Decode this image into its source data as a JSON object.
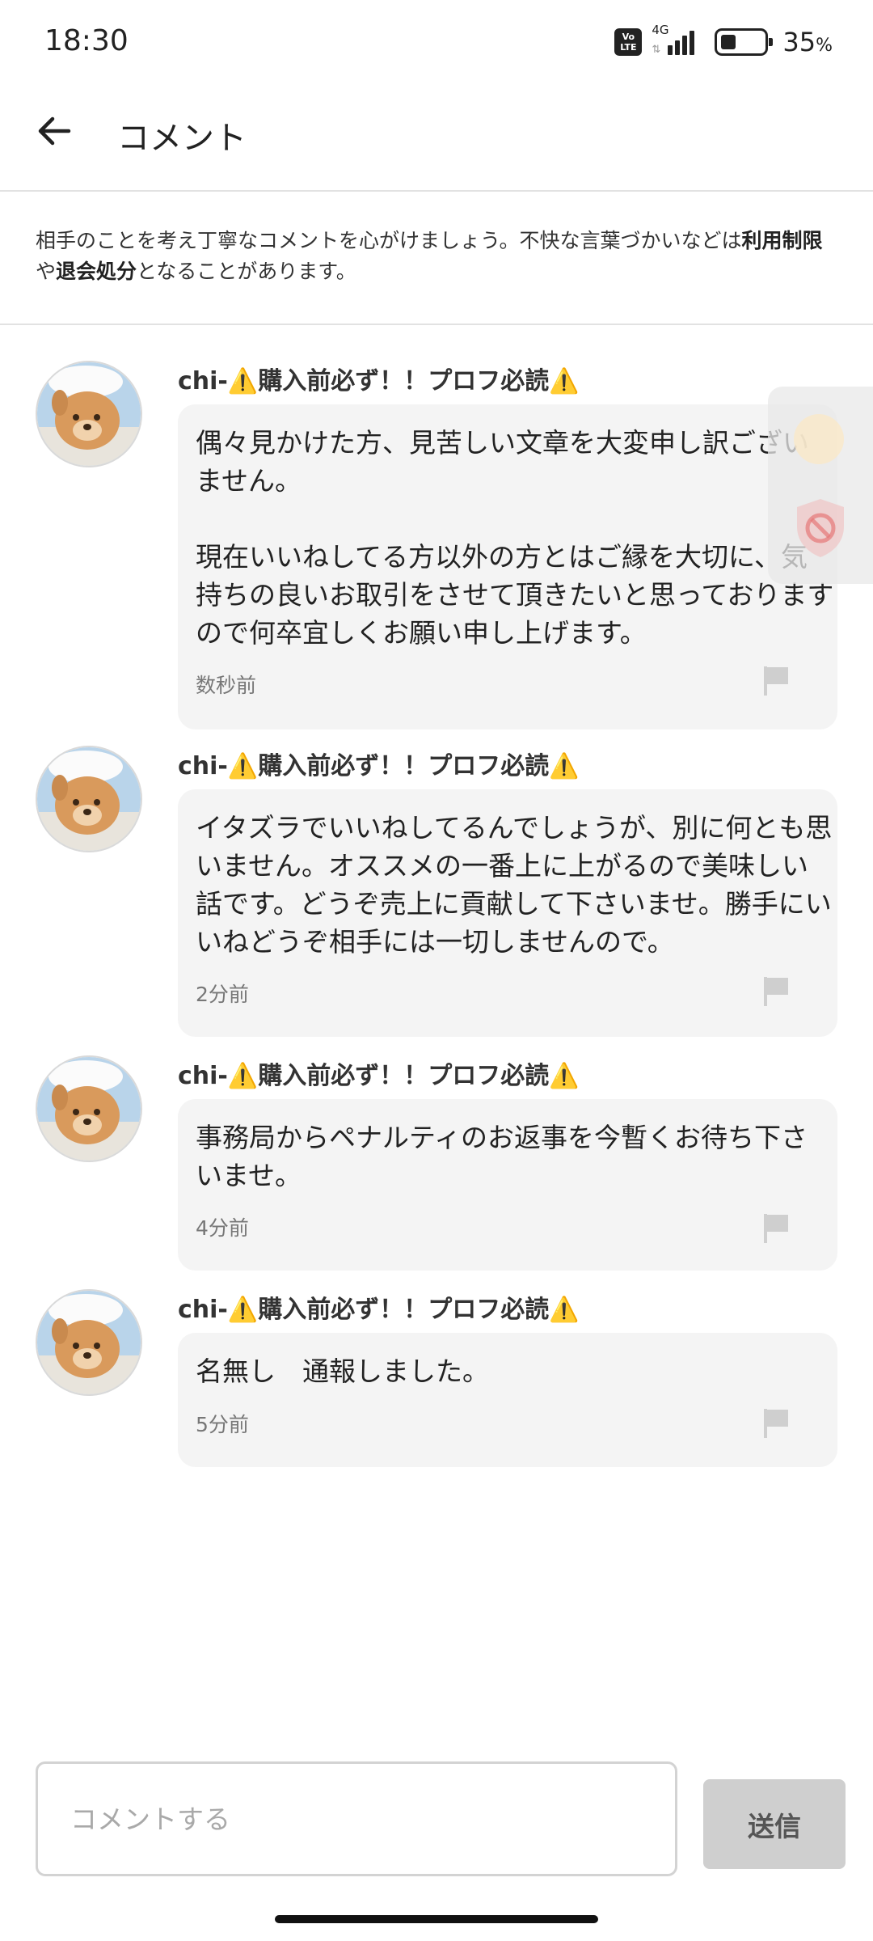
{
  "status_bar": {
    "time": "18:30",
    "volte": "Vo LTE",
    "network": "4G",
    "signal_level": 4,
    "battery_level": 0.35,
    "battery_percent": "35",
    "battery_unit": "%"
  },
  "header": {
    "title": "コメント"
  },
  "notice": {
    "text_1": "相手のことを考え丁寧なコメントを心がけましょう。不快な言葉づかいなどは",
    "bold_1": "利用制限",
    "text_2": "や",
    "bold_2": "退会処分",
    "text_3": "となることがあります。"
  },
  "comments": [
    {
      "author": "chi-⚠️購入前必ず！！プロフ必読⚠️",
      "text": "偶々見かけた方、見苦しい文章を大変申し訳ございません。\n\n現在いいねしてる方以外の方とはご縁を大切に、気持ちの良いお取引をさせて頂きたいと思っておりますので何卒宜しくお願い申し上げます。",
      "time": "数秒前"
    },
    {
      "author": "chi-⚠️購入前必ず！！プロフ必読⚠️",
      "text": "イタズラでいいねしてるんでしょうが、別に何とも思いません。オススメの一番上に上がるので美味しい話です。どうぞ売上に貢献して下さいませ。勝手にいいねどうぞ相手には一切しませんので。",
      "time": "2分前"
    },
    {
      "author": "chi-⚠️購入前必ず！！プロフ必読⚠️",
      "text": "事務局からペナルティのお返事を今暫くお待ち下さいませ。",
      "time": "4分前"
    },
    {
      "author": "chi-⚠️購入前必ず！！プロフ必読⚠️",
      "text": "名無し　通報しました。",
      "time": "5分前"
    }
  ],
  "input": {
    "placeholder": "コメントする",
    "value": ""
  },
  "send_button": {
    "label": "送信"
  },
  "colors": {
    "bubble": "#f4f4f4",
    "send_disabled": "#cfcfcf",
    "divider": "#e2e2e2"
  }
}
